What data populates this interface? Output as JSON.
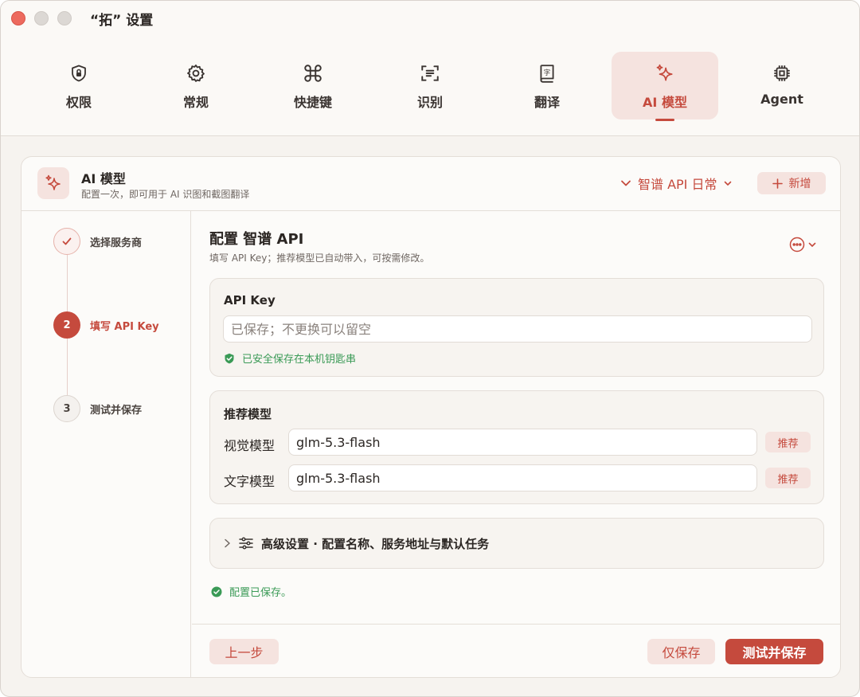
{
  "window": {
    "title": "“拓” 设置"
  },
  "toolbar": {
    "tabs": [
      {
        "label": "权限",
        "icon": "lock-shield-icon"
      },
      {
        "label": "常规",
        "icon": "gear-icon"
      },
      {
        "label": "快捷键",
        "icon": "command-icon"
      },
      {
        "label": "识别",
        "icon": "text-scan-icon"
      },
      {
        "label": "翻译",
        "icon": "dictionary-icon"
      },
      {
        "label": "AI 模型",
        "icon": "sparkles-icon",
        "active": true
      },
      {
        "label": "Agent",
        "icon": "chip-icon"
      }
    ]
  },
  "card": {
    "title": "AI 模型",
    "subtitle": "配置一次，即可用于 AI 识图和截图翻译",
    "provider_select": "智谱 API 日常",
    "add_label": "新增"
  },
  "steps": [
    {
      "number": "✓",
      "label": "选择服务商",
      "state": "done"
    },
    {
      "number": "2",
      "label": "填写 API Key",
      "state": "current"
    },
    {
      "number": "3",
      "label": "测试并保存",
      "state": "pending"
    }
  ],
  "main": {
    "title": "配置 智谱 API",
    "subtitle": "填写 API Key；推荐模型已自动带入，可按需修改。",
    "api_key": {
      "title": "API Key",
      "value": "",
      "placeholder": "已保存；不更换可以留空",
      "saved_note": "已安全保存在本机钥匙串"
    },
    "models": {
      "title": "推荐模型",
      "vision_label": "视觉模型",
      "vision_value": "glm-5.3-flash",
      "text_label": "文字模型",
      "text_value": "glm-5.3-flash",
      "recommend_label": "推荐"
    },
    "advanced_label": "高级设置 · 配置名称、服务地址与默认任务",
    "status": "配置已保存。"
  },
  "footer": {
    "prev": "上一步",
    "save_only": "仅保存",
    "test_save": "测试并保存"
  },
  "colors": {
    "accent": "#c54a3d",
    "accent_soft": "#f5e3df",
    "success": "#3a9a56",
    "background": "#f6f3ef"
  }
}
